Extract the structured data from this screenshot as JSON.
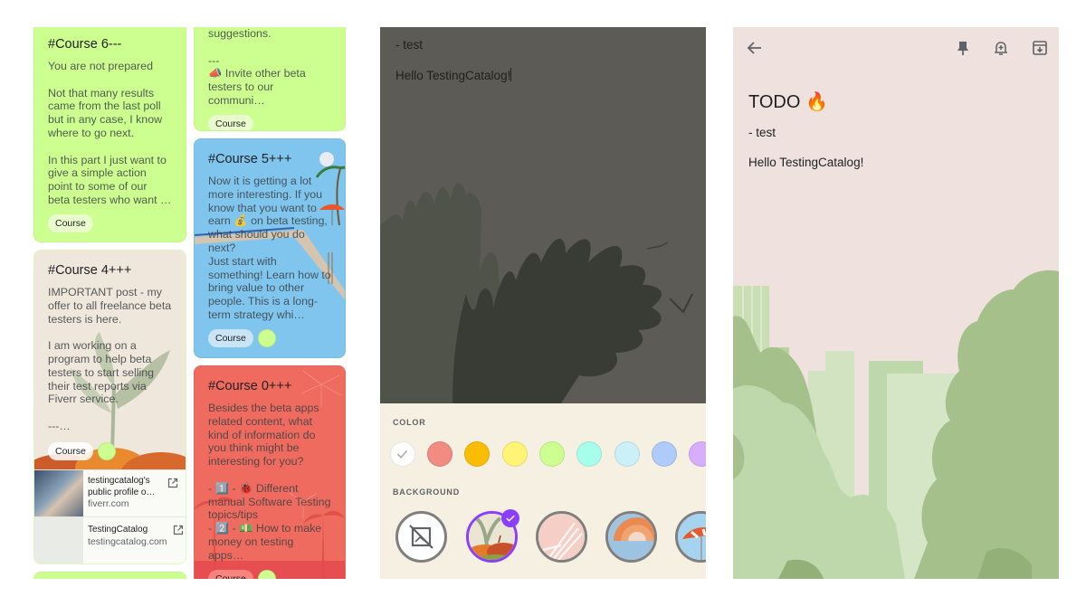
{
  "notes_grid": {
    "cards": [
      {
        "id": "course6",
        "title": "#Course 6---",
        "body": "You are not prepared\n\nNot that many results came from the last poll but in any case, I know where to go next.\n\nIn this part I just want to give a simple action point to some of our beta testers who want …",
        "label": "Course",
        "color": "#ccff90"
      },
      {
        "id": "course4",
        "title": "#Course 4+++",
        "body": "IMPORTANT post - my offer to all freelance beta testers is here.\n\nI am working on a program to help beta testers to start selling their test reports via Fiverr service.\n\n---…",
        "label": "Course",
        "color": "#efe7dc",
        "links": [
          {
            "title": "testingcatalog's public profile o…",
            "domain": "fiverr.com"
          },
          {
            "title": "TestingCatalog",
            "domain": "testingcatalog.com"
          }
        ]
      },
      {
        "id": "partial-top",
        "body": "suggestions.\n\n---\n📣  Invite other beta testers to our communi…",
        "label": "Course",
        "color": "#ccff90"
      },
      {
        "id": "course5",
        "title": "#Course 5+++",
        "body": "Now it is getting a lot more interesting. If you know that you want to earn 💰 on beta testing, what should you do next?\nJust start with something! Learn how to bring value to other people. This is a long-term strategy whi…",
        "label": "Course",
        "color": "#7fc5ee"
      },
      {
        "id": "course0",
        "title": "#Course 0+++",
        "body": "Besides the beta apps related content, what kind of information do you think might be interesting for you?\n\n- 1️⃣ - 🐞 Different manual Software Testing topics/tips\n- 2️⃣ - 💵 How to make money on testing apps…",
        "label": "Course",
        "color": "#ef6b5f"
      }
    ]
  },
  "editor": {
    "line1": "- test",
    "line2": "Hello TestingCatalog!",
    "color_label": "COLOR",
    "background_label": "BACKGROUND",
    "colors": [
      {
        "name": "default",
        "hex": "#ffffff",
        "selected": true
      },
      {
        "name": "coral",
        "hex": "#f28b82"
      },
      {
        "name": "peach",
        "hex": "#fbbc04"
      },
      {
        "name": "sand",
        "hex": "#fff475"
      },
      {
        "name": "mint",
        "hex": "#ccff90"
      },
      {
        "name": "sage",
        "hex": "#a7ffeb"
      },
      {
        "name": "fog",
        "hex": "#cbf0f8"
      },
      {
        "name": "storm",
        "hex": "#aecbfa"
      },
      {
        "name": "dusk",
        "hex": "#d7aefb"
      }
    ],
    "backgrounds": [
      {
        "name": "none",
        "selected": false
      },
      {
        "name": "groceries",
        "selected": true
      },
      {
        "name": "food",
        "selected": false
      },
      {
        "name": "music",
        "selected": false
      },
      {
        "name": "recipes",
        "selected": false
      }
    ],
    "accent": "#8a3ffc"
  },
  "note_view": {
    "title": "TODO 🔥",
    "line1": "- test",
    "line2": "Hello TestingCatalog!",
    "toolbar": [
      "back-icon",
      "pin-icon",
      "reminder-icon",
      "archive-icon"
    ]
  }
}
